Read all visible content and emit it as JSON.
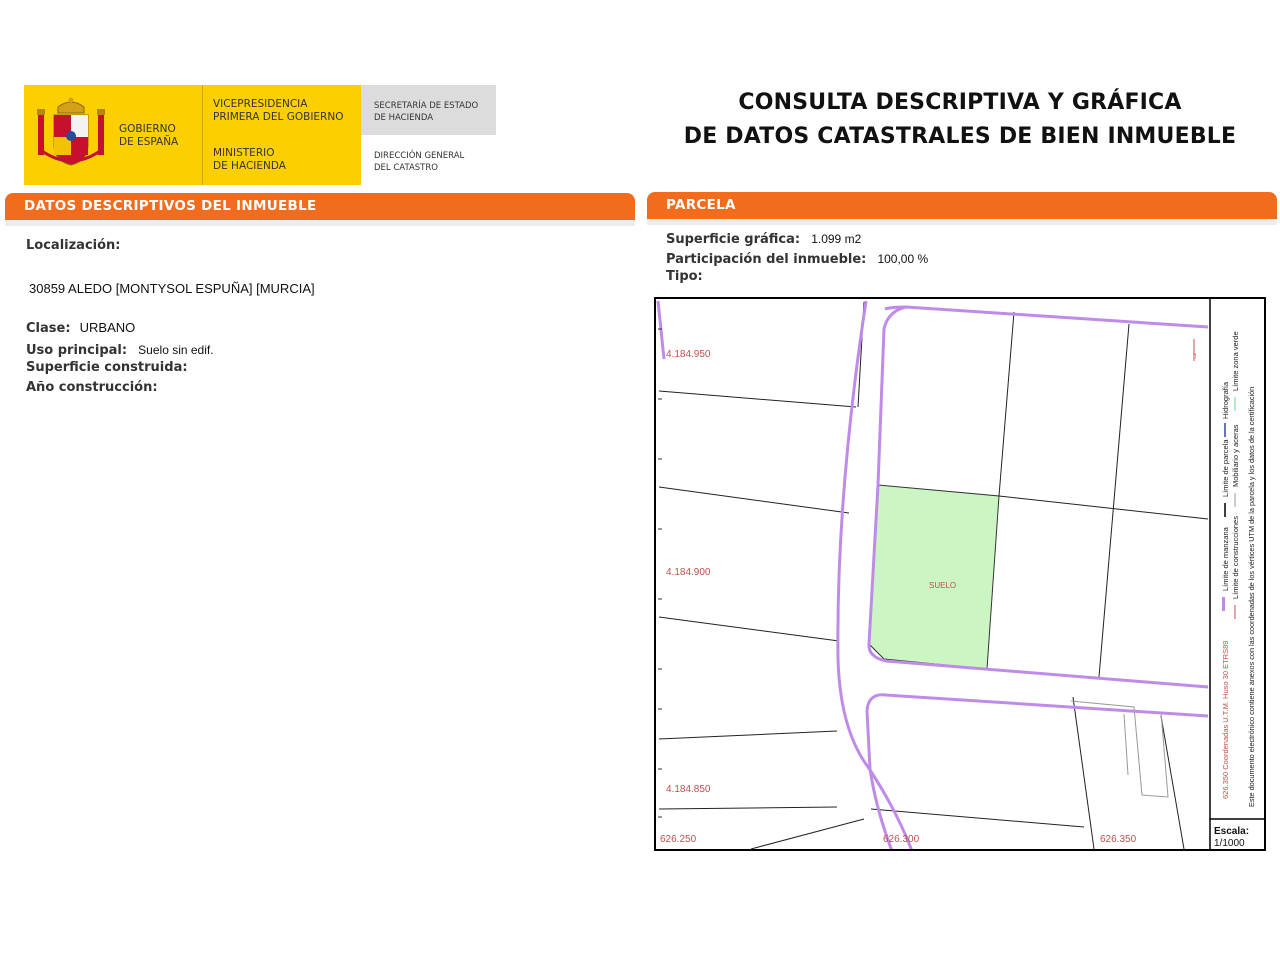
{
  "header": {
    "gov_line1": "GOBIERNO",
    "gov_line2": "DE ESPAÑA",
    "vice_line1": "VICEPRESIDENCIA",
    "vice_line2": "PRIMERA DEL GOBIERNO",
    "min_line1": "MINISTERIO",
    "min_line2": "DE HACIENDA",
    "sec_line1": "SECRETARÍA DE ESTADO",
    "sec_line2": "DE HACIENDA",
    "dir_line1": "DIRECCIÓN GENERAL",
    "dir_line2": "DEL CATASTRO",
    "title_line1": "CONSULTA DESCRIPTIVA Y GRÁFICA",
    "title_line2": "DE DATOS CATASTRALES DE BIEN INMUEBLE",
    "colors": {
      "logo_yellow": "#FCD000",
      "logo_gray": "#DCDCDC",
      "accent_orange": "#F26C1E"
    }
  },
  "left": {
    "section_title": "DATOS DESCRIPTIVOS DEL INMUEBLE",
    "localizacion_label": "Localización:",
    "address": "30859 ALEDO [MONTYSOL ESPUÑA] [MURCIA]",
    "clase_label": "Clase:",
    "clase_value": "URBANO",
    "uso_label": "Uso principal:",
    "uso_value": "Suelo sin edif.",
    "superficie_label": "Superficie construida:",
    "anio_label": "Año construcción:"
  },
  "right": {
    "section_title": "PARCELA",
    "sup_grafica_label": "Superficie gráfica:",
    "sup_grafica_value": "1.099 m2",
    "participacion_label": "Participación del inmueble:",
    "participacion_value": "100,00 %",
    "tipo_label": "Tipo:"
  },
  "map": {
    "y_coords": [
      "4.184.950",
      "4.184.900",
      "4.184.850"
    ],
    "x_coords": [
      "626.250",
      "626.300",
      "626.350"
    ],
    "parcel_label": "SUELO",
    "parcel_color": "#CCF5C4",
    "street_color": "#C08BE8",
    "coord_color": "#C0504D",
    "legend": {
      "utm_note": "626.350 Coordenadas U.T.M. Huso 30 ETRS89",
      "manzana": "Límite de manzana",
      "parcela": "Límite de parcela",
      "hidrografia": "Hidrografía",
      "construcciones": "Límite de construcciones",
      "mobiliario": "Mobiliario y aceras",
      "zona_verde": "Límite zona verde",
      "doc_note": "Este documento electrónico contiene anexos con las coordenadas de los vértices UTM de la parcela y los datos de la certificación",
      "escala_label": "Escala:",
      "escala_value": "1/1000"
    }
  }
}
